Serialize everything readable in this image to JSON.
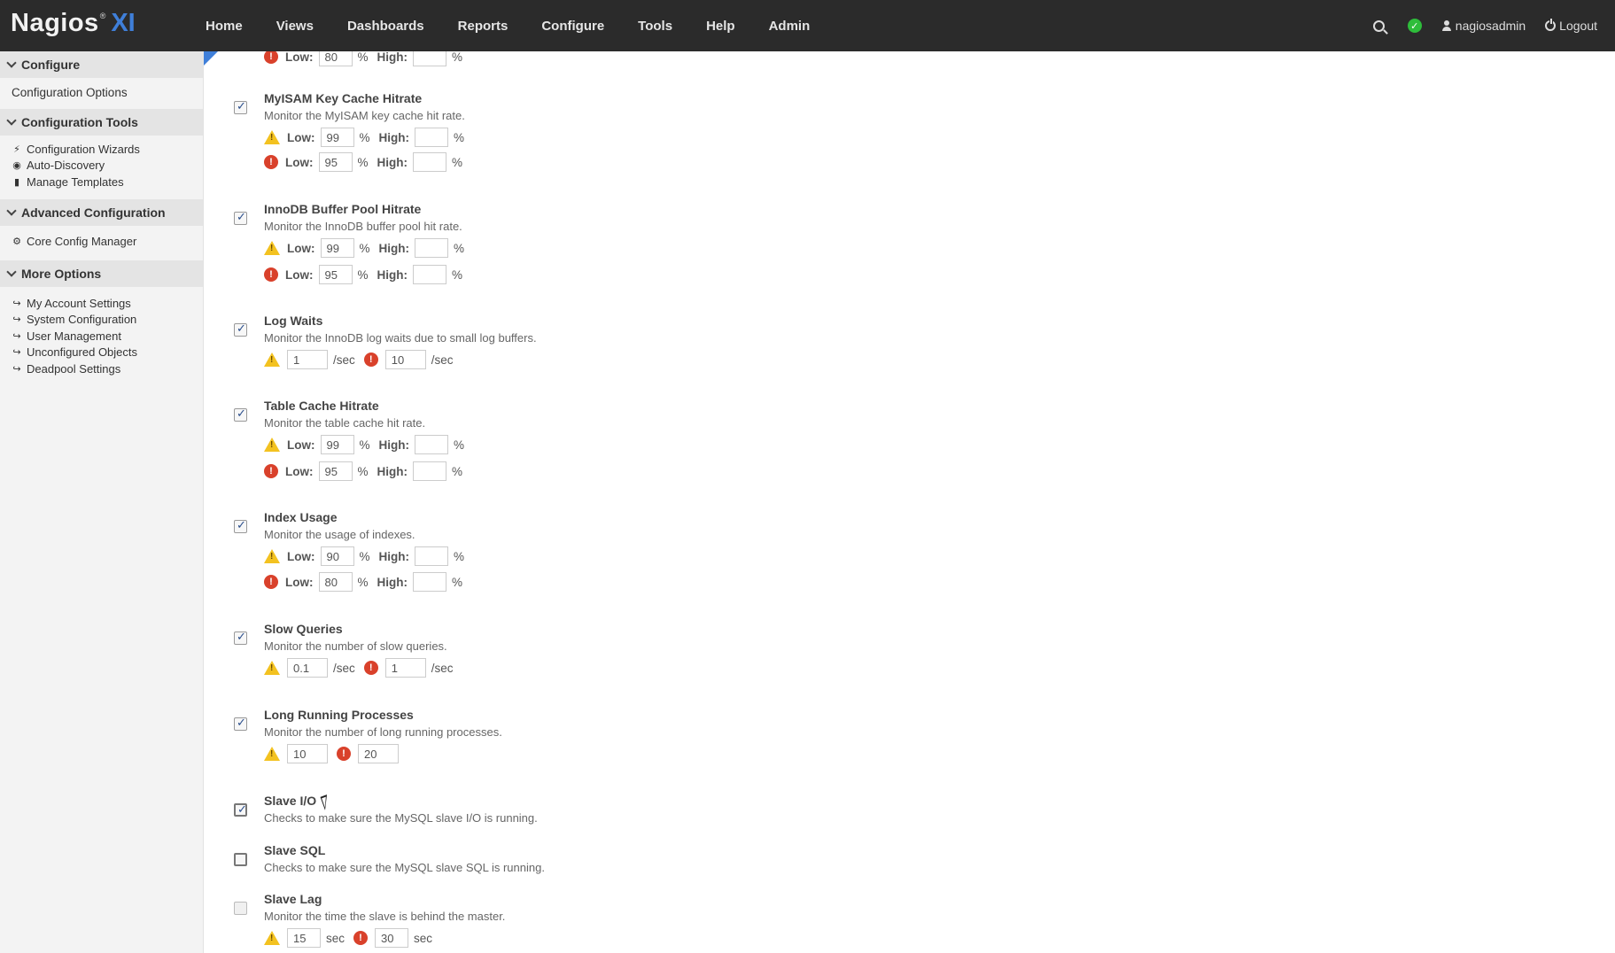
{
  "logo": {
    "brand": "Nagios",
    "reg": "®",
    "xi": "XI"
  },
  "nav": [
    "Home",
    "Views",
    "Dashboards",
    "Reports",
    "Configure",
    "Tools",
    "Help",
    "Admin"
  ],
  "user": {
    "name": "nagiosadmin",
    "logout": "Logout",
    "status_glyph": "✓"
  },
  "sidebar": {
    "configure": {
      "title": "Configure",
      "items": [
        "Configuration Options"
      ]
    },
    "config_tools": {
      "title": "Configuration Tools",
      "items": [
        "Configuration Wizards",
        "Auto-Discovery",
        "Manage Templates"
      ]
    },
    "advanced": {
      "title": "Advanced Configuration",
      "items": [
        "Core Config Manager"
      ]
    },
    "more": {
      "title": "More Options",
      "items": [
        "My Account Settings",
        "System Configuration",
        "User Management",
        "Unconfigured Objects",
        "Deadpool Settings"
      ]
    }
  },
  "labels": {
    "low": "Low:",
    "high": "High:",
    "pct": "%",
    "per_sec": "/sec",
    "sec": "sec",
    "crit_glyph": "!"
  },
  "top_partial": {
    "low": "80"
  },
  "checks": [
    {
      "title": "MyISAM Key Cache Hitrate",
      "desc": "Monitor the MyISAM key cache hit rate.",
      "checked": true,
      "warn_low": "99",
      "crit_low": "95"
    },
    {
      "title": "InnoDB Buffer Pool Hitrate",
      "desc": "Monitor the InnoDB buffer pool hit rate.",
      "checked": true,
      "warn_low": "99",
      "crit_low": "95"
    },
    {
      "title": "Log Waits",
      "desc": "Monitor the InnoDB log waits due to small log buffers.",
      "checked": true,
      "warn": "1",
      "crit": "10"
    },
    {
      "title": "Table Cache Hitrate",
      "desc": "Monitor the table cache hit rate.",
      "checked": true,
      "warn_low": "99",
      "crit_low": "95"
    },
    {
      "title": "Index Usage",
      "desc": "Monitor the usage of indexes.",
      "checked": true,
      "warn_low": "90",
      "crit_low": "80"
    },
    {
      "title": "Slow Queries",
      "desc": "Monitor the number of slow queries.",
      "checked": true,
      "warn": "0.1",
      "crit": "1"
    },
    {
      "title": "Long Running Processes",
      "desc": "Monitor the number of long running processes.",
      "checked": true,
      "warn": "10",
      "crit": "20"
    },
    {
      "title": "Slave I/O",
      "desc": "Checks to make sure the MySQL slave I/O is running.",
      "checked": true
    },
    {
      "title": "Slave SQL",
      "desc": "Checks to make sure the MySQL slave SQL is running.",
      "checked": false
    },
    {
      "title": "Slave Lag",
      "desc": "Monitor the time the slave is behind the master.",
      "checked": false,
      "warn": "15",
      "crit": "30"
    }
  ]
}
